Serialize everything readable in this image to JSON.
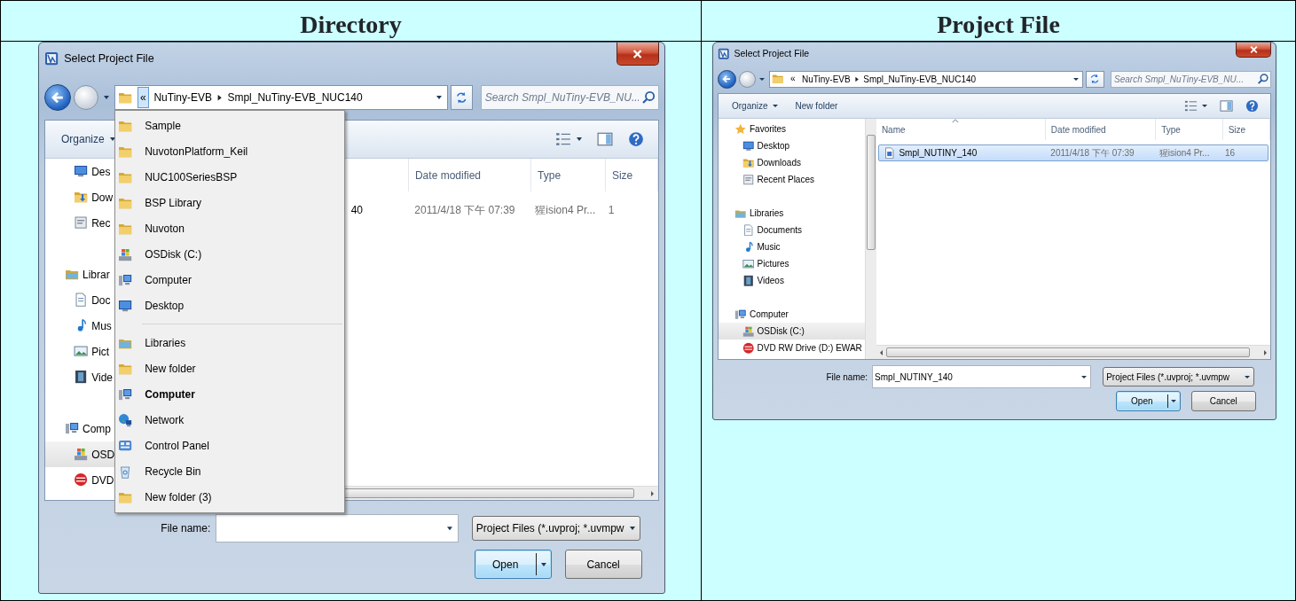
{
  "columns": [
    {
      "heading": "Directory",
      "dialog": {
        "title": "Select Project File",
        "address": {
          "overflow": "«",
          "overflow_open": true,
          "segments": [
            "NuTiny-EVB",
            "Smpl_NuTiny-EVB_NUC140"
          ]
        },
        "search": {
          "placeholder": "Search Smpl_NuTiny-EVB_NU..."
        },
        "toolbar": [
          {
            "label": "Organize",
            "menu": true
          }
        ],
        "nav_scrollbar": false,
        "nav": [
          {
            "children": [
              {
                "label": "Des",
                "kind": "desktop",
                "selected": false
              },
              {
                "label": "Dow",
                "kind": "downloads",
                "selected": false
              },
              {
                "label": "Rec",
                "kind": "recent",
                "selected": false
              }
            ]
          },
          {
            "label": "Librar",
            "kind": "library",
            "selected": false,
            "children": [
              {
                "label": "Doc",
                "kind": "document",
                "selected": false
              },
              {
                "label": "Mus",
                "kind": "music",
                "selected": false
              },
              {
                "label": "Pict",
                "kind": "pictures",
                "selected": false
              },
              {
                "label": "Vide",
                "kind": "videos",
                "selected": false
              }
            ]
          },
          {
            "label": "Comp",
            "kind": "computer",
            "selected": false,
            "children": [
              {
                "label": "OSD",
                "kind": "drive",
                "selected": true
              },
              {
                "label": "DVD",
                "kind": "dvd",
                "selected": false
              }
            ]
          }
        ],
        "columns": [
          {
            "kind": "name"
          },
          {
            "kind": "date",
            "label": "Date modified"
          },
          {
            "kind": "type",
            "label": "Type"
          },
          {
            "kind": "size",
            "label": "Size"
          }
        ],
        "files": [
          {
            "selected": false,
            "cells": [
              "40",
              "2011/4/18 下午 07:39",
              "猩ision4 Pr...",
              "1"
            ]
          }
        ],
        "location_menu": {
          "sections": [
            [
              {
                "label": "Sample",
                "kind": "folder",
                "current": false
              },
              {
                "label": "NuvotonPlatform_Keil",
                "kind": "folder",
                "current": false
              },
              {
                "label": "NUC100SeriesBSP",
                "kind": "folder",
                "current": false
              },
              {
                "label": "BSP Library",
                "kind": "folder",
                "current": false
              },
              {
                "label": "Nuvoton",
                "kind": "folder",
                "current": false
              },
              {
                "label": "OSDisk (C:)",
                "kind": "drive",
                "current": false
              },
              {
                "label": "Computer",
                "kind": "computer",
                "current": false
              },
              {
                "label": "Desktop",
                "kind": "desktop",
                "current": false
              }
            ],
            [
              {
                "label": "Libraries",
                "kind": "library",
                "current": false
              },
              {
                "label": "New folder",
                "kind": "folder",
                "current": false
              },
              {
                "label": "Computer",
                "kind": "computer",
                "current": true
              },
              {
                "label": "Network",
                "kind": "network",
                "current": false
              },
              {
                "label": "Control Panel",
                "kind": "control_panel",
                "current": false
              },
              {
                "label": "Recycle Bin",
                "kind": "recycle_bin",
                "current": false
              },
              {
                "label": "New folder (3)",
                "kind": "folder",
                "current": false
              }
            ]
          ]
        },
        "file_name": {
          "label": "File name:"
        },
        "file_type": "Project Files (*.uvproj; *.uvmpw",
        "buttons": [
          {
            "label": "Open",
            "split": true,
            "default": true
          },
          {
            "label": "Cancel",
            "split": false,
            "default": false
          }
        ]
      }
    },
    {
      "heading": "Project File",
      "dialog": {
        "title": "Select Project File",
        "address": {
          "overflow": "«",
          "overflow_open": false,
          "segments": [
            "NuTiny-EVB",
            "Smpl_NuTiny-EVB_NUC140"
          ]
        },
        "search": {
          "placeholder": "Search Smpl_NuTiny-EVB_NU..."
        },
        "toolbar": [
          {
            "label": "Organize",
            "menu": true
          },
          {
            "label": "New folder",
            "menu": false
          }
        ],
        "nav_scrollbar": true,
        "nav": [
          {
            "label": "Favorites",
            "kind": "star",
            "selected": false,
            "children": [
              {
                "label": "Desktop",
                "kind": "desktop",
                "selected": false
              },
              {
                "label": "Downloads",
                "kind": "downloads",
                "selected": false
              },
              {
                "label": "Recent Places",
                "kind": "recent",
                "selected": false
              }
            ]
          },
          {
            "label": "Libraries",
            "kind": "library",
            "selected": false,
            "children": [
              {
                "label": "Documents",
                "kind": "document",
                "selected": false
              },
              {
                "label": "Music",
                "kind": "music",
                "selected": false
              },
              {
                "label": "Pictures",
                "kind": "pictures",
                "selected": false
              },
              {
                "label": "Videos",
                "kind": "videos",
                "selected": false
              }
            ]
          },
          {
            "label": "Computer",
            "kind": "computer",
            "selected": false,
            "children": [
              {
                "label": "OSDisk (C:)",
                "kind": "drive",
                "selected": true
              },
              {
                "label": "DVD RW Drive (D:) EWAR",
                "kind": "dvd",
                "selected": false
              }
            ]
          }
        ],
        "columns": [
          {
            "kind": "name",
            "label": "Name",
            "sorted": true
          },
          {
            "kind": "date",
            "label": "Date modified",
            "sorted": false
          },
          {
            "kind": "type",
            "label": "Type",
            "sorted": false
          },
          {
            "kind": "size",
            "label": "Size",
            "sorted": false
          }
        ],
        "files": [
          {
            "selected": true,
            "kind": "project",
            "cells": [
              "Smpl_NUTINY_140",
              "2011/4/18 下午 07:39",
              "猩ision4 Pr...",
              "16"
            ]
          }
        ],
        "file_name": {
          "label": "File name:",
          "value": "Smpl_NUTINY_140"
        },
        "file_type": "Project Files (*.uvproj; *.uvmpw",
        "buttons": [
          {
            "label": "Open",
            "split": true,
            "default": true
          },
          {
            "label": "Cancel",
            "split": false,
            "default": false
          }
        ]
      }
    }
  ]
}
